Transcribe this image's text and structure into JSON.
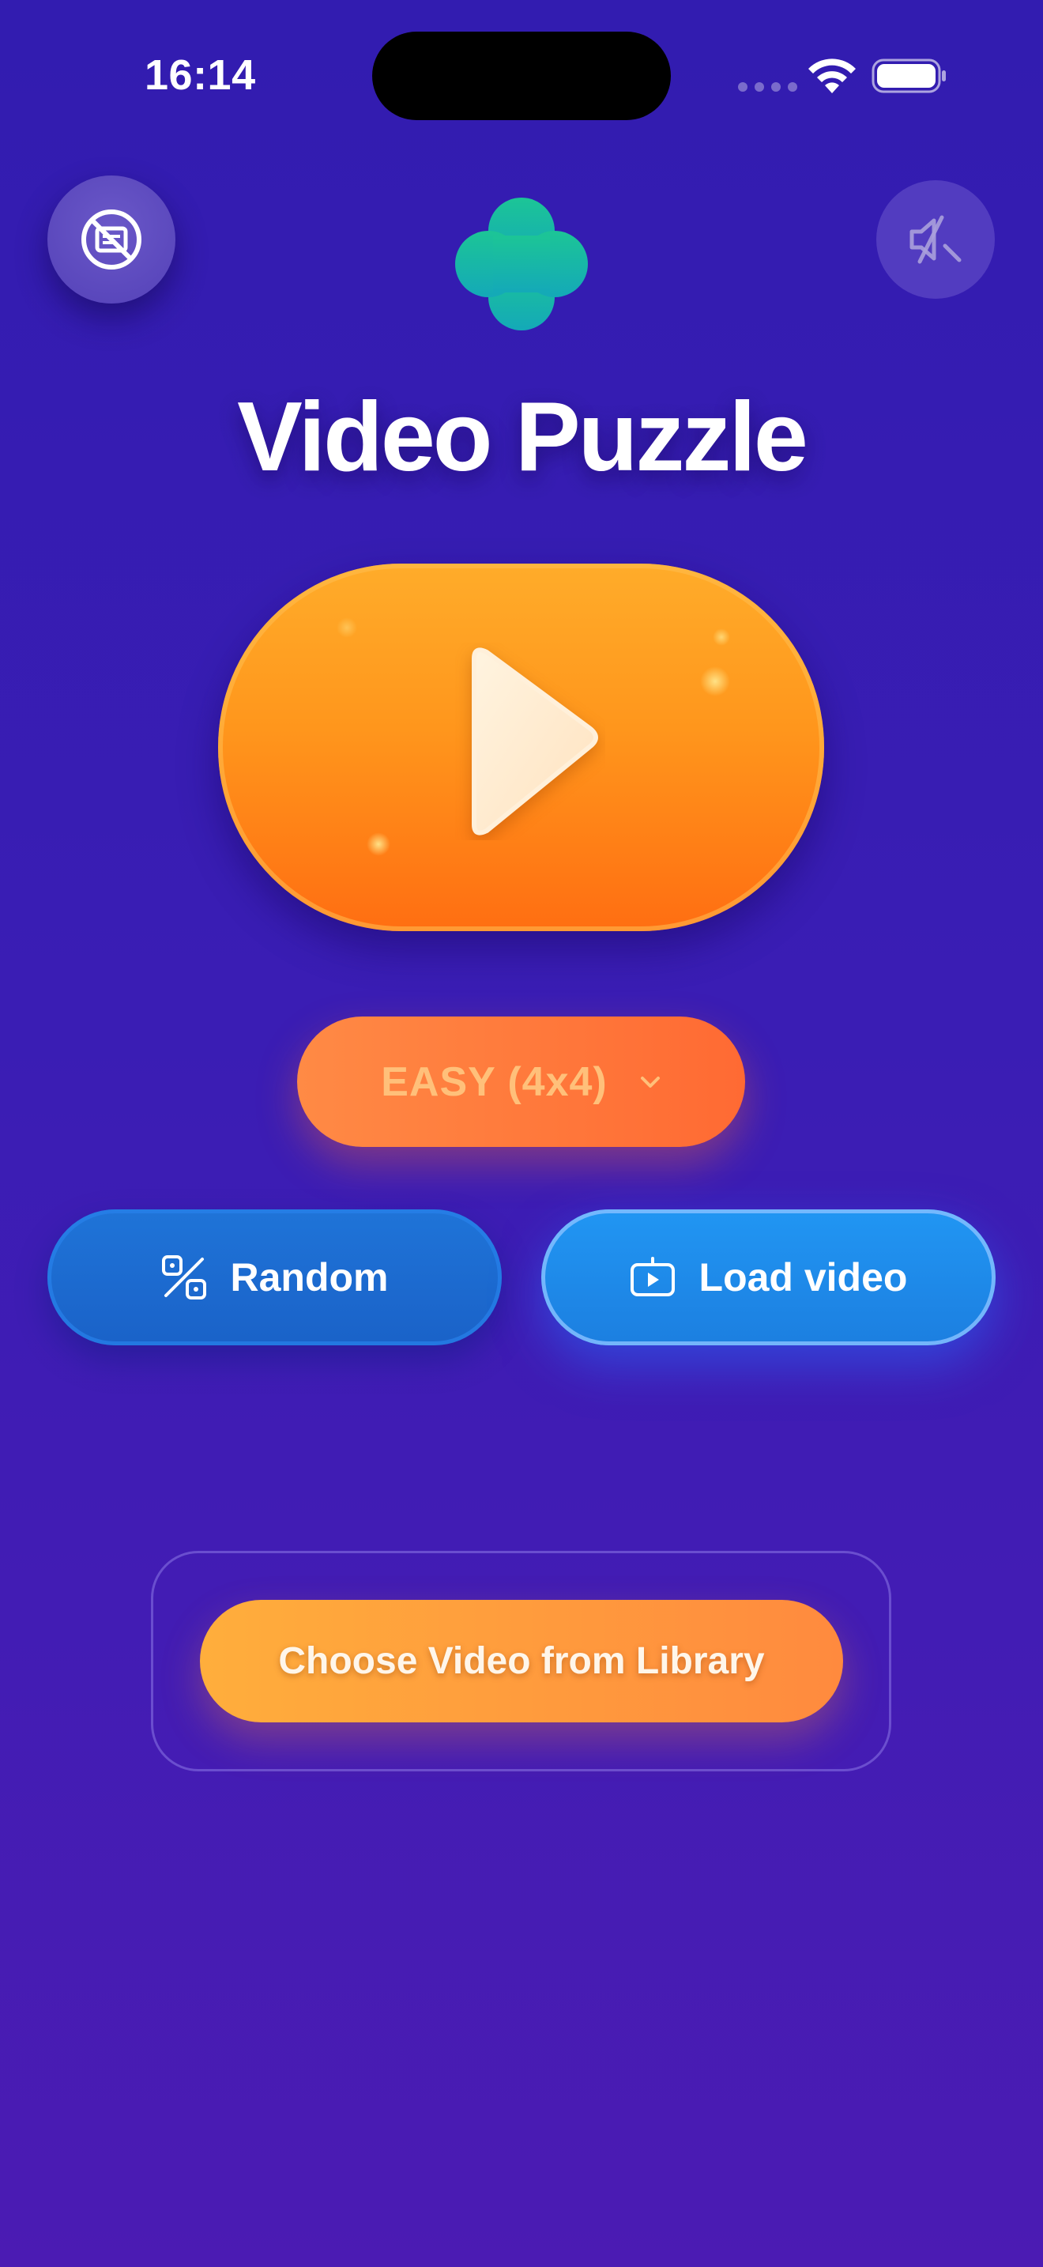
{
  "status_bar": {
    "time": "16:14"
  },
  "header": {
    "title": "Video Puzzle",
    "logo_icon": "clover-icon",
    "left_control_icon": "subtitles-off-icon",
    "right_control_icon": "speaker-muted-icon"
  },
  "main": {
    "play_icon": "play-icon",
    "difficulty": {
      "selected": "EASY (4x4)",
      "icon": "chevron-down-icon"
    },
    "random_button": {
      "label": "Random",
      "icon": "dice-icon"
    },
    "load_video_button": {
      "label": "Load video",
      "icon": "tv-play-icon"
    },
    "library_button": {
      "label": "Choose Video from Library"
    }
  },
  "colors": {
    "background": "#3a1db4",
    "play_button": "#ff961c",
    "difficulty_pill": "#ff7a3c",
    "random_button": "#1a62c8",
    "load_video_button": "#2196f3",
    "library_button": "#ff9a3c",
    "logo": "#18b5a0"
  }
}
